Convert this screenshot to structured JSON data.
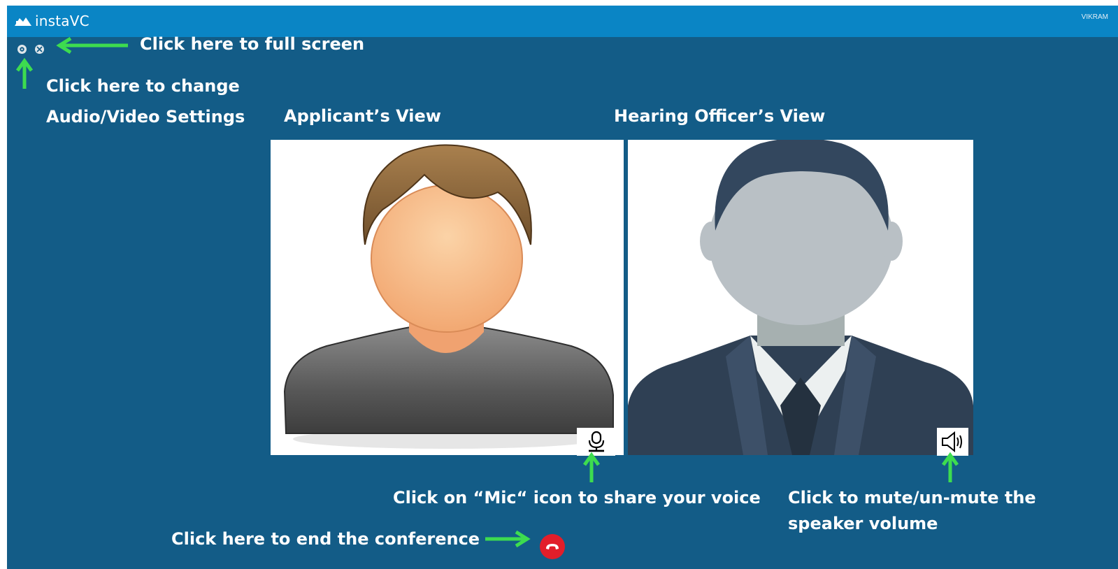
{
  "window": {
    "app_name": "instaVC",
    "user_name": "VIKRAM"
  },
  "controls": {
    "settings_icon": "gear-icon",
    "fullscreen_icon": "fullscreen-icon"
  },
  "views": {
    "applicant_label": "Applicant’s View",
    "officer_label": "Hearing Officer’s View",
    "mic_icon": "microphone-icon",
    "speaker_icon": "speaker-icon",
    "end_call_icon": "phone-hangup-icon"
  },
  "annotations": {
    "fullscreen": "Click here to full screen",
    "settings_line1": "Click here to change",
    "settings_line2": "Audio/Video Settings",
    "mic": "Click on “Mic“ icon to share your voice",
    "speaker_line1": "Click to mute/un-mute the",
    "speaker_line2": "speaker volume",
    "end_call": "Click here to end the conference"
  },
  "colors": {
    "title_bar": "#0a85c5",
    "background": "#135c87",
    "arrow": "#3ddc4f",
    "end_call": "#e21e2a",
    "annotation_text": "#ffffff"
  }
}
